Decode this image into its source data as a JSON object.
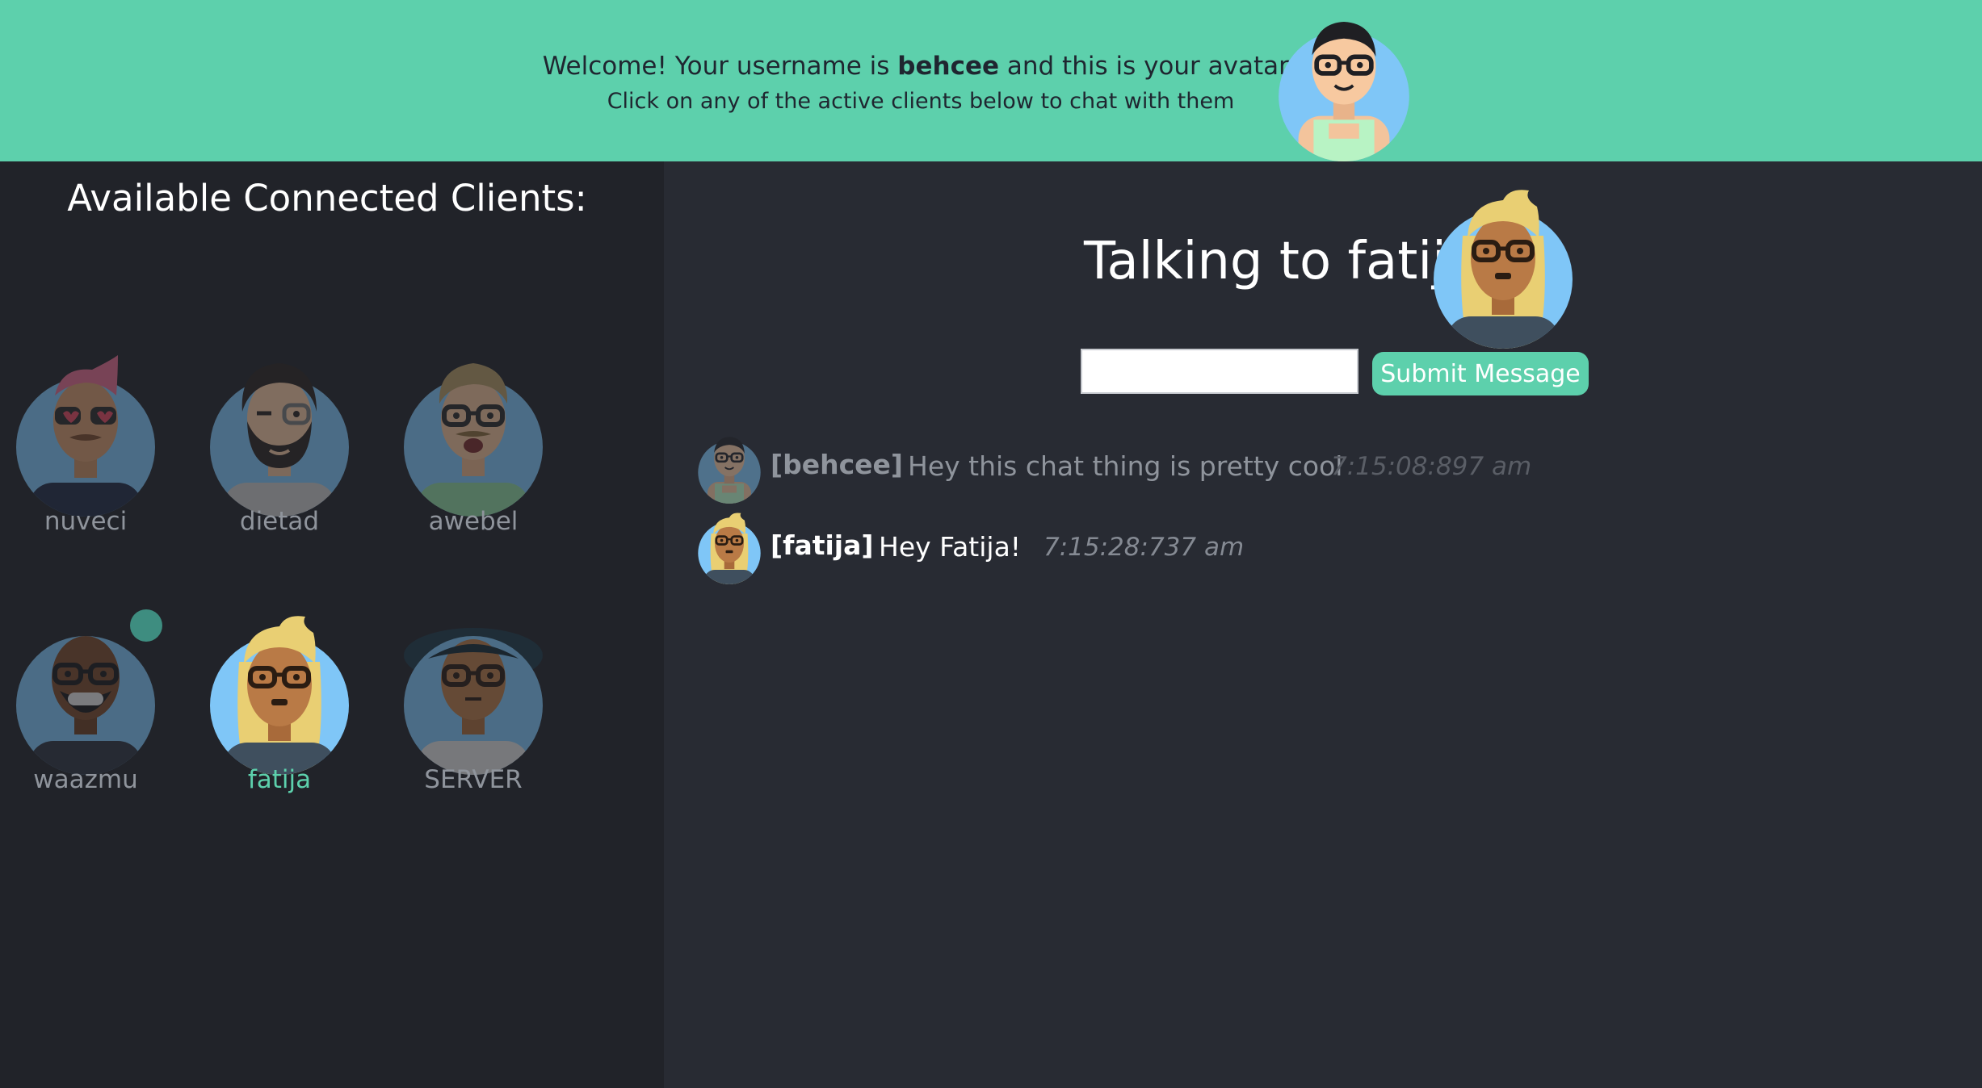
{
  "header": {
    "welcome_prefix": "Welcome! Your username is",
    "username": "behcee",
    "welcome_suffix": "and this is your avatar!",
    "hint": "Click on any of the active clients below to chat with them"
  },
  "sidebar": {
    "title": "Available Connected Clients:",
    "clients": [
      {
        "name": "nuveci",
        "avatar": "avatar-pink-hair-heart-glasses-icon"
      },
      {
        "name": "dietad",
        "avatar": "avatar-bearded-winking-icon"
      },
      {
        "name": "awebel",
        "avatar": "avatar-mustache-open-mouth-icon"
      },
      {
        "name": "waazmu",
        "avatar": "avatar-bald-grinning-icon"
      },
      {
        "name": "fatija",
        "avatar": "avatar-blonde-glasses-icon"
      },
      {
        "name": "SERVER",
        "avatar": "avatar-wide-hat-icon"
      }
    ],
    "selected": "fatija"
  },
  "chat": {
    "talking_to": "Talking to fatija",
    "input_value": "",
    "submit_label": "Submit Message",
    "messages": [
      {
        "sender": "[behcee]",
        "text": "Hey this chat thing is pretty cool",
        "time": "7:15:08:897 am"
      },
      {
        "sender": "[fatija]",
        "text": "Hey Fatija!",
        "time": "7:15:28:737 am"
      }
    ]
  },
  "colors": {
    "accent": "#5dd0ac",
    "sidebar_bg": "#212329",
    "main_bg": "#282b33",
    "avatar_bg": "#7fc6f7",
    "notification_dot": "#3e8d80"
  }
}
